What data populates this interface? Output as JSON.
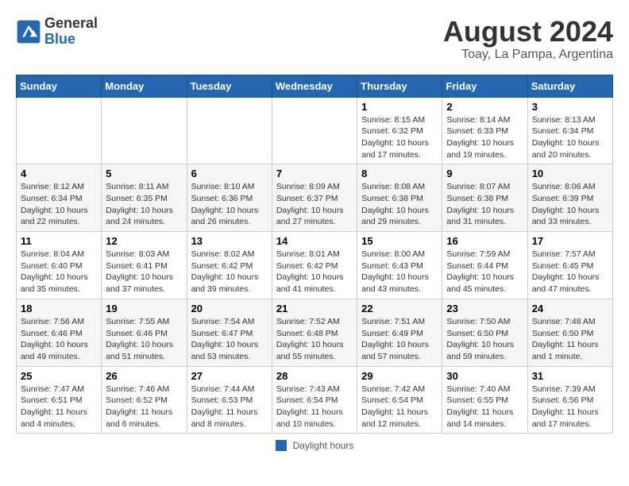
{
  "header": {
    "logo_general": "General",
    "logo_blue": "Blue",
    "month_title": "August 2024",
    "location": "Toay, La Pampa, Argentina"
  },
  "days_of_week": [
    "Sunday",
    "Monday",
    "Tuesday",
    "Wednesday",
    "Thursday",
    "Friday",
    "Saturday"
  ],
  "weeks": [
    [
      {
        "day": "",
        "sunrise": "",
        "sunset": "",
        "daylight": ""
      },
      {
        "day": "",
        "sunrise": "",
        "sunset": "",
        "daylight": ""
      },
      {
        "day": "",
        "sunrise": "",
        "sunset": "",
        "daylight": ""
      },
      {
        "day": "",
        "sunrise": "",
        "sunset": "",
        "daylight": ""
      },
      {
        "day": "1",
        "sunrise": "8:15 AM",
        "sunset": "6:32 PM",
        "daylight": "10 hours and 17 minutes."
      },
      {
        "day": "2",
        "sunrise": "8:14 AM",
        "sunset": "6:33 PM",
        "daylight": "10 hours and 19 minutes."
      },
      {
        "day": "3",
        "sunrise": "8:13 AM",
        "sunset": "6:34 PM",
        "daylight": "10 hours and 20 minutes."
      }
    ],
    [
      {
        "day": "4",
        "sunrise": "8:12 AM",
        "sunset": "6:34 PM",
        "daylight": "10 hours and 22 minutes."
      },
      {
        "day": "5",
        "sunrise": "8:11 AM",
        "sunset": "6:35 PM",
        "daylight": "10 hours and 24 minutes."
      },
      {
        "day": "6",
        "sunrise": "8:10 AM",
        "sunset": "6:36 PM",
        "daylight": "10 hours and 26 minutes."
      },
      {
        "day": "7",
        "sunrise": "8:09 AM",
        "sunset": "6:37 PM",
        "daylight": "10 hours and 27 minutes."
      },
      {
        "day": "8",
        "sunrise": "8:08 AM",
        "sunset": "6:38 PM",
        "daylight": "10 hours and 29 minutes."
      },
      {
        "day": "9",
        "sunrise": "8:07 AM",
        "sunset": "6:38 PM",
        "daylight": "10 hours and 31 minutes."
      },
      {
        "day": "10",
        "sunrise": "8:06 AM",
        "sunset": "6:39 PM",
        "daylight": "10 hours and 33 minutes."
      }
    ],
    [
      {
        "day": "11",
        "sunrise": "8:04 AM",
        "sunset": "6:40 PM",
        "daylight": "10 hours and 35 minutes."
      },
      {
        "day": "12",
        "sunrise": "8:03 AM",
        "sunset": "6:41 PM",
        "daylight": "10 hours and 37 minutes."
      },
      {
        "day": "13",
        "sunrise": "8:02 AM",
        "sunset": "6:42 PM",
        "daylight": "10 hours and 39 minutes."
      },
      {
        "day": "14",
        "sunrise": "8:01 AM",
        "sunset": "6:42 PM",
        "daylight": "10 hours and 41 minutes."
      },
      {
        "day": "15",
        "sunrise": "8:00 AM",
        "sunset": "6:43 PM",
        "daylight": "10 hours and 43 minutes."
      },
      {
        "day": "16",
        "sunrise": "7:59 AM",
        "sunset": "6:44 PM",
        "daylight": "10 hours and 45 minutes."
      },
      {
        "day": "17",
        "sunrise": "7:57 AM",
        "sunset": "6:45 PM",
        "daylight": "10 hours and 47 minutes."
      }
    ],
    [
      {
        "day": "18",
        "sunrise": "7:56 AM",
        "sunset": "6:46 PM",
        "daylight": "10 hours and 49 minutes."
      },
      {
        "day": "19",
        "sunrise": "7:55 AM",
        "sunset": "6:46 PM",
        "daylight": "10 hours and 51 minutes."
      },
      {
        "day": "20",
        "sunrise": "7:54 AM",
        "sunset": "6:47 PM",
        "daylight": "10 hours and 53 minutes."
      },
      {
        "day": "21",
        "sunrise": "7:52 AM",
        "sunset": "6:48 PM",
        "daylight": "10 hours and 55 minutes."
      },
      {
        "day": "22",
        "sunrise": "7:51 AM",
        "sunset": "6:49 PM",
        "daylight": "10 hours and 57 minutes."
      },
      {
        "day": "23",
        "sunrise": "7:50 AM",
        "sunset": "6:50 PM",
        "daylight": "10 hours and 59 minutes."
      },
      {
        "day": "24",
        "sunrise": "7:48 AM",
        "sunset": "6:50 PM",
        "daylight": "11 hours and 1 minute."
      }
    ],
    [
      {
        "day": "25",
        "sunrise": "7:47 AM",
        "sunset": "6:51 PM",
        "daylight": "11 hours and 4 minutes."
      },
      {
        "day": "26",
        "sunrise": "7:46 AM",
        "sunset": "6:52 PM",
        "daylight": "11 hours and 6 minutes."
      },
      {
        "day": "27",
        "sunrise": "7:44 AM",
        "sunset": "6:53 PM",
        "daylight": "11 hours and 8 minutes."
      },
      {
        "day": "28",
        "sunrise": "7:43 AM",
        "sunset": "6:54 PM",
        "daylight": "11 hours and 10 minutes."
      },
      {
        "day": "29",
        "sunrise": "7:42 AM",
        "sunset": "6:54 PM",
        "daylight": "11 hours and 12 minutes."
      },
      {
        "day": "30",
        "sunrise": "7:40 AM",
        "sunset": "6:55 PM",
        "daylight": "11 hours and 14 minutes."
      },
      {
        "day": "31",
        "sunrise": "7:39 AM",
        "sunset": "6:56 PM",
        "daylight": "11 hours and 17 minutes."
      }
    ]
  ],
  "footer": {
    "legend_label": "Daylight hours"
  }
}
